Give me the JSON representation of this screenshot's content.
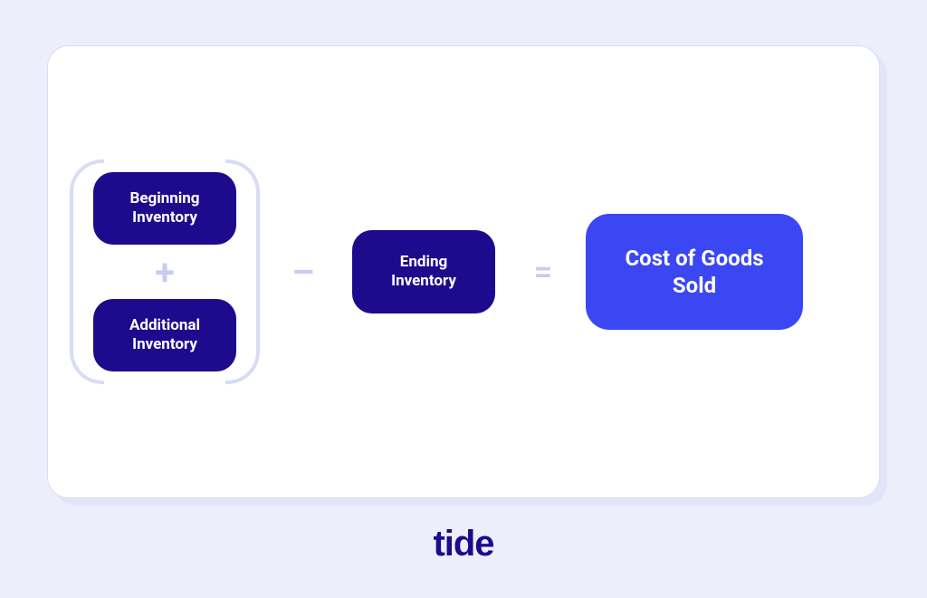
{
  "formula": {
    "term1": "Beginning Inventory",
    "op_plus": "+",
    "term2": "Additional Inventory",
    "op_minus": "–",
    "term3": "Ending Inventory",
    "op_equals": "=",
    "result": "Cost of Goods Sold"
  },
  "brand": "tide"
}
